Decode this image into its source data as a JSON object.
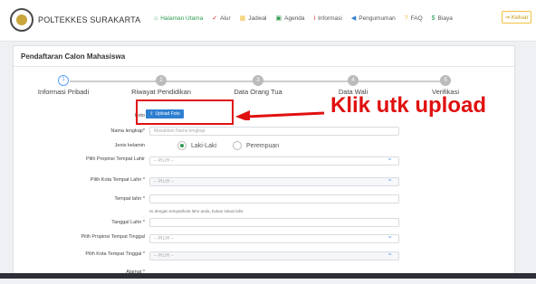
{
  "brand": {
    "name": "POLTEKKES SURAKARTA"
  },
  "nav": {
    "items": [
      {
        "label": "Halaman Utama",
        "icon": "home-icon",
        "color": "#2e9b4f"
      },
      {
        "label": "Alur",
        "icon": "check-icon",
        "color": "#e01010"
      },
      {
        "label": "Jadwal",
        "icon": "calendar-icon",
        "color": "#f0c040"
      },
      {
        "label": "Agenda",
        "icon": "agenda-icon",
        "color": "#2e9b4f"
      },
      {
        "label": "Informasi",
        "icon": "info-icon",
        "color": "#e01010"
      },
      {
        "label": "Pengumuman",
        "icon": "megaphone-icon",
        "color": "#2f7fd1"
      },
      {
        "label": "FAQ",
        "icon": "question-icon",
        "color": "#f0c040"
      },
      {
        "label": "Biaya",
        "icon": "dollar-icon",
        "color": "#2e9b4f"
      }
    ],
    "logout_label": "Keluar"
  },
  "page": {
    "title": "Pendaftaran Calon Mahasiswa"
  },
  "steps": [
    {
      "num": "1",
      "label": "Informasi Pribadi"
    },
    {
      "num": "2",
      "label": "Riwayat Pendidikan"
    },
    {
      "num": "3",
      "label": "Data Orang Tua"
    },
    {
      "num": "4",
      "label": "Data Wali"
    },
    {
      "num": "5",
      "label": "Verifikasi"
    }
  ],
  "form": {
    "foto_label": "Foto",
    "upload_label": "Upload Foto",
    "nama_label": "Nama lengkap*",
    "nama_placeholder": "Masukkan Nama lengkap",
    "jk_label": "Jenis kelamin",
    "jk_options": [
      "Laki-Laki",
      "Perempuan"
    ],
    "jk_selected": "Laki-Laki",
    "prov_lahir_label": "Pilih Propinsi Tempat Lahir",
    "prov_lahir_value": "-- PILIH --",
    "kota_lahir_label": "Pilih Kota Tempat Lahir *",
    "kota_lahir_value": "-- PILIH --",
    "tempat_lahir_label": "Tempat lahir *",
    "tempat_lahir_hint": "Isi dengan tempat/kota lahir anda, bukan lokasi lahir",
    "tgl_lahir_label": "Tanggal Lahir *",
    "prov_tinggal_label": "Pilih Propinsi Tempat Tinggal",
    "prov_tinggal_value": "-- PILIH --",
    "kota_tinggal_label": "Pilih Kota Tempat Tinggal *",
    "kota_tinggal_value": "-- PILIH --",
    "alamat_label": "Alamat *"
  },
  "annotation": {
    "text": "Klik utk upload"
  }
}
